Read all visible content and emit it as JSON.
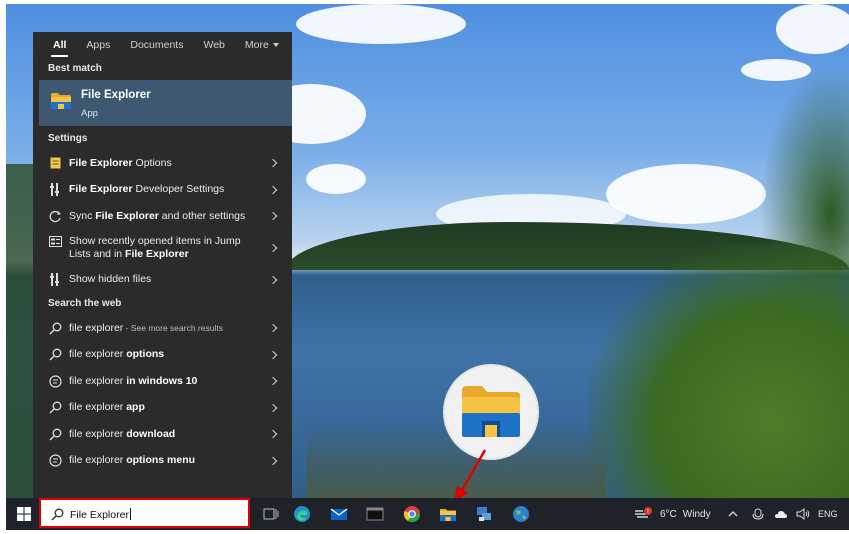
{
  "search_panel": {
    "tabs": [
      {
        "label": "All",
        "active": true
      },
      {
        "label": "Apps"
      },
      {
        "label": "Documents"
      },
      {
        "label": "Web"
      },
      {
        "label": "More",
        "icon": "chevron-down-icon"
      }
    ],
    "best_match": {
      "title": "Best match",
      "name": "File Explorer",
      "type": "App",
      "icon": "folder-icon"
    },
    "settings": {
      "title": "Settings",
      "items": [
        {
          "bold": "File Explorer",
          "rest": " Options",
          "icon": "options-icon"
        },
        {
          "bold": "File Explorer",
          "rest": " Developer Settings",
          "icon": "developer-settings-icon"
        },
        {
          "pre": "Sync ",
          "bold": "File Explorer",
          "rest": " and other settings",
          "icon": "sync-icon"
        },
        {
          "pre": "Show recently opened items in Jump Lists and in ",
          "bold": "File Explorer",
          "rest": "",
          "icon": "jump-list-icon"
        },
        {
          "pre": "Show hidden files",
          "bold": "",
          "rest": "",
          "icon": "developer-settings-icon"
        }
      ]
    },
    "web": {
      "title": "Search the web",
      "items": [
        {
          "pre": "file explorer",
          "bold": "",
          "small": " - See more search results",
          "icon": "search-icon"
        },
        {
          "pre": "file explorer ",
          "bold": "options",
          "icon": "search-icon"
        },
        {
          "pre": "file explorer ",
          "bold": "in windows 10",
          "icon": "web-result-icon"
        },
        {
          "pre": "file explorer ",
          "bold": "app",
          "icon": "search-icon"
        },
        {
          "pre": "file explorer ",
          "bold": "download",
          "icon": "search-icon"
        },
        {
          "pre": "file explorer ",
          "bold": "options menu",
          "icon": "web-result-icon"
        }
      ]
    }
  },
  "taskbar": {
    "search_value": "File Explorer",
    "pinned": [
      "task-view-icon",
      "edge-icon",
      "mail-icon",
      "terminal-icon",
      "chrome-icon",
      "file-explorer-icon",
      "network-app-icon",
      "globe-icon"
    ],
    "weather": {
      "temp": "6°C",
      "condition": "Windy"
    },
    "language": "ENG"
  },
  "colors": {
    "panel_bg": "#2b2b2b",
    "best_match_bg": "#3f5871",
    "taskbar_bg": "#1f2228",
    "highlight_border": "#e00000",
    "folder_yellow": "#f6c343",
    "folder_blue": "#1e73c8"
  }
}
